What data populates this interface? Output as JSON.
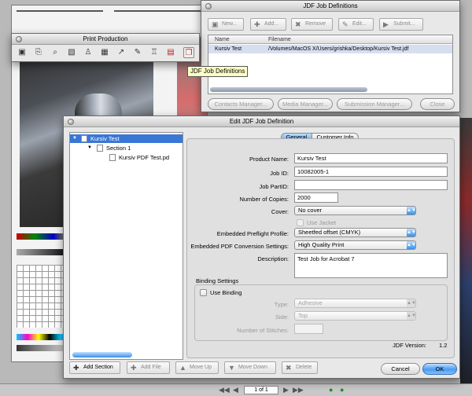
{
  "jdf_window": {
    "title": "JDF Job Definitions",
    "toolbar": [
      "New...",
      "Add...",
      "Remove",
      "Edit...",
      "Submit..."
    ],
    "columns": [
      "Name",
      "Filename"
    ],
    "rows": [
      {
        "name": "Kursiv Test",
        "filename": "/Volumes/MacOS X/Users/grishka/Desktop/Kursiv Test.jdf"
      }
    ],
    "buttons": [
      "Contacts Manager...",
      "Media Manager...",
      "Submission Manager...",
      "Close"
    ]
  },
  "print_production": {
    "title": "Print Production",
    "tooltip": "JDF Job Definitions",
    "tools": [
      "▣",
      "⎘",
      "⌕",
      "▧",
      "♙",
      "▦",
      "↗",
      "✎",
      "♖",
      "▤",
      "❐"
    ]
  },
  "edit_window": {
    "title": "Edit JDF Job Definition",
    "tree": {
      "root": "Kursiv Test",
      "section": "Section 1",
      "file": "Kursiv PDF Test.pd"
    },
    "tabs": [
      "General",
      "Customer Info"
    ],
    "fields": {
      "product_name": {
        "label": "Product Name:",
        "value": "Kursiv Test"
      },
      "job_id": {
        "label": "Job ID:",
        "value": "10082005-1"
      },
      "job_part_id": {
        "label": "Job PartID:",
        "value": ""
      },
      "copies": {
        "label": "Number of Copies:",
        "value": "2000"
      },
      "cover": {
        "label": "Cover:",
        "value": "No cover"
      },
      "use_jacket": {
        "label": "Use Jacket"
      },
      "preflight": {
        "label": "Embedded Preflight Profile:",
        "value": "Sheetfed offset (CMYK)"
      },
      "pdf_settings": {
        "label": "Embedded PDF Conversion Settings:",
        "value": "High Quality Print"
      },
      "description": {
        "label": "Description:",
        "value": "Test Job for Acrobat 7"
      }
    },
    "binding": {
      "title": "Binding Settings",
      "use_binding": "Use Binding",
      "type": {
        "label": "Type:",
        "value": "Adhesive"
      },
      "side": {
        "label": "Side:",
        "value": "Top"
      },
      "stitches": {
        "label": "Number of Stitches:",
        "value": ""
      }
    },
    "jdf_version": {
      "label": "JDF Version:",
      "value": "1.2"
    },
    "toolbar": [
      "Add Section",
      "Add File",
      "Move Up",
      "Move Down",
      "Delete"
    ],
    "cancel": "Cancel",
    "ok": "OK"
  },
  "status": {
    "page": "1 of 1"
  }
}
